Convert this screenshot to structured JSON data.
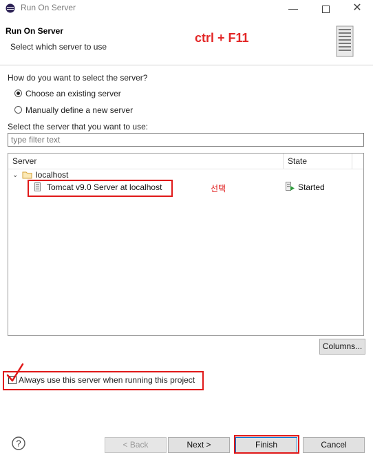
{
  "window": {
    "title": "Run On Server",
    "icon": "eclipse-icon",
    "controls": [
      "minimize-icon",
      "maximize-icon",
      "close-icon"
    ]
  },
  "header": {
    "title": "Run On Server",
    "subtitle": "Select which server to use",
    "annotation": "ctrl + F11"
  },
  "selection": {
    "question": "How do you want to select the server?",
    "options": [
      {
        "label": "Choose an existing server",
        "selected": true
      },
      {
        "label": "Manually define a new server",
        "selected": false
      }
    ]
  },
  "server_list": {
    "prompt": "Select the server that you want to use:",
    "filter_placeholder": "type filter text",
    "columns": [
      "Server",
      "State"
    ],
    "tree": {
      "group": "localhost",
      "items": [
        {
          "name": "Tomcat v9.0 Server at localhost",
          "state": "Started"
        }
      ]
    },
    "annotation": "선택"
  },
  "columns_button": "Columns...",
  "always_use": {
    "label": "Always use this server when running this project",
    "checked": true
  },
  "buttons": {
    "back": "< Back",
    "next": "Next >",
    "finish": "Finish",
    "cancel": "Cancel"
  },
  "colors": {
    "annotation_red": "#e01818",
    "folder": "#e8b84b",
    "started_green": "#2e9a3c"
  }
}
